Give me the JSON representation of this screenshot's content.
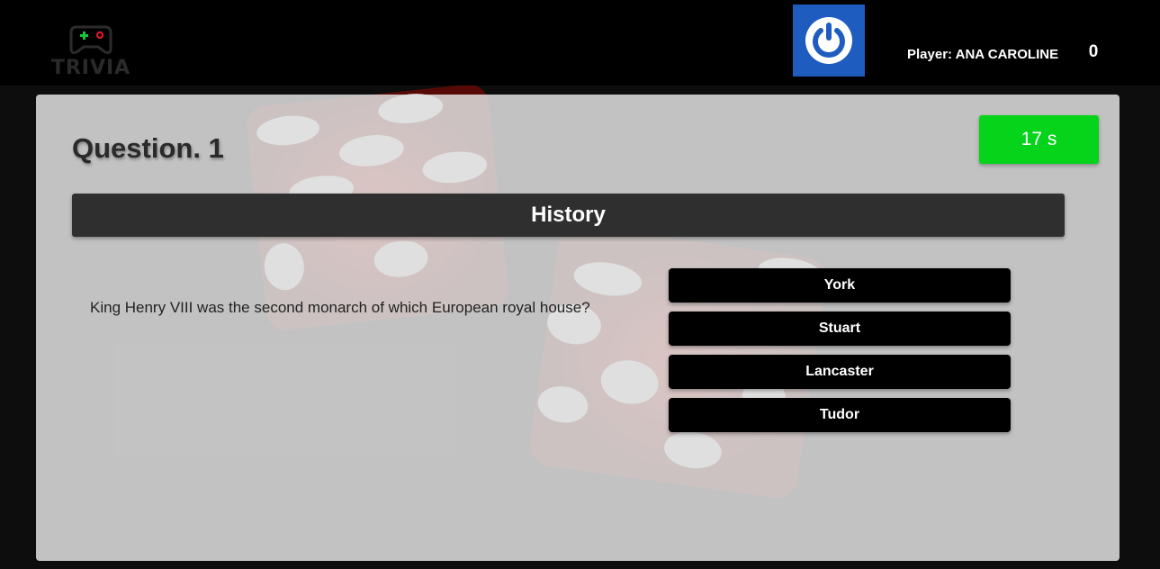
{
  "header": {
    "logo_text": "TRIVIA",
    "logo_icon": "gamepad-icon",
    "power_icon": "power-icon",
    "player_label": "Player: ANA CAROLINE",
    "score": "0"
  },
  "quiz": {
    "question_title": "Question. 1",
    "timer": "17 s",
    "category": "History",
    "question": "King Henry VIII was the second monarch of which European royal house?",
    "answers": [
      "York",
      "Stuart",
      "Lancaster",
      "Tudor"
    ]
  },
  "colors": {
    "header_bg": "#000000",
    "power_button": "#1e5cc0",
    "timer": "#05d41b",
    "category_bar": "#2f2f2f",
    "answer_button": "#000000",
    "dice": "#c41a12"
  }
}
